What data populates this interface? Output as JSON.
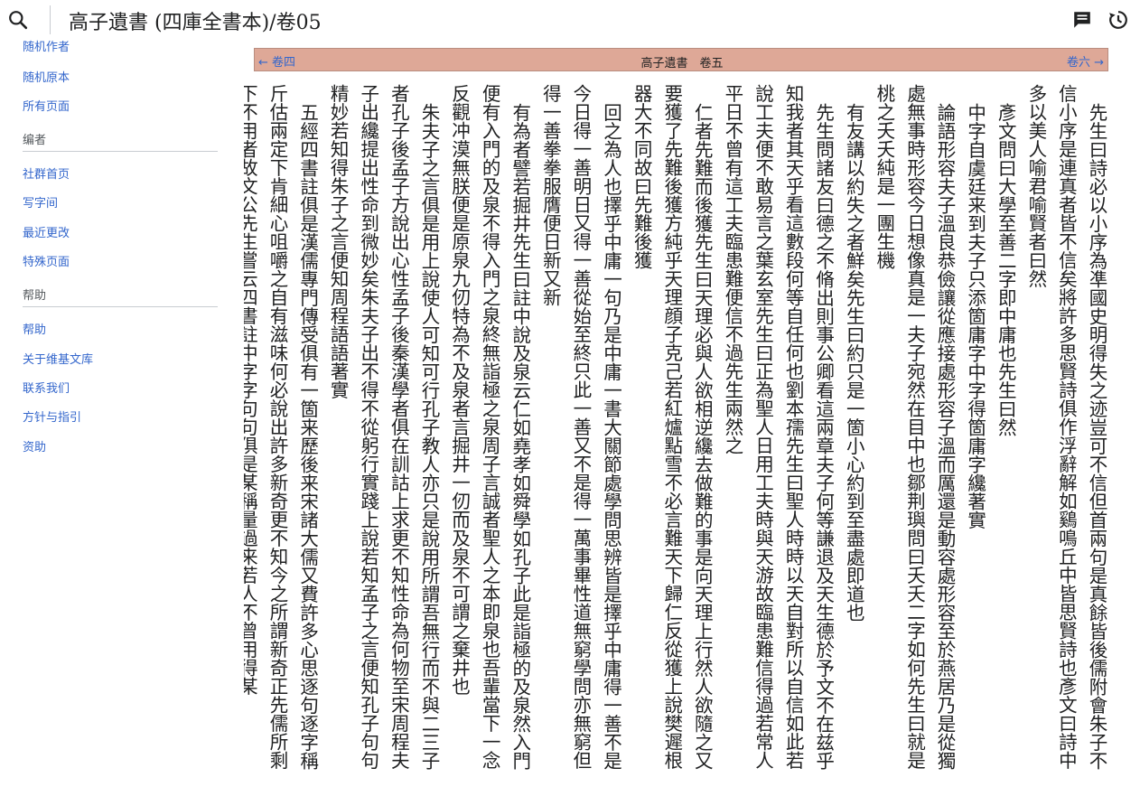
{
  "header": {
    "title": "高子遺書 (四庫全書本)/卷05",
    "icons": {
      "search": "search-icon",
      "talk": "talk-icon",
      "history": "history-icon"
    }
  },
  "sidebar": {
    "top_items": [
      "随机作者",
      "随机原本",
      "所有页面"
    ],
    "editor_heading": "编者",
    "editor_items": [
      "社群首页",
      "写字间",
      "最近更改",
      "特殊页面"
    ],
    "help_heading": "帮助",
    "help_items": [
      "帮助",
      "关于维基文库",
      "联系我们",
      "方针与指引",
      "资助"
    ]
  },
  "nav": {
    "prev": "← 卷四",
    "center": "高子遺書　卷五",
    "next": "卷六 →"
  },
  "text": {
    "paragraphs": [
      {
        "indent": true,
        "text": "先生曰詩必以小序為凖國史明得失之迹豈可不信但首兩句是真餘皆後儒附會朱子不信小序是連真者皆不信矣將許多思賢詩俱作浮辭解如鷄鳴丘中皆思賢詩也彥文曰詩中多以美人喻君喻賢者曰然"
      },
      {
        "indent": true,
        "text": "彥文問曰大學至善二字即中庸也先生曰然"
      },
      {
        "indent": true,
        "text": "中字自虞廷来到夫子只添箇庸字中字得箇庸字纔著實"
      },
      {
        "indent": true,
        "text": "論語形容夫子溫良恭儉讓從應接處形容子溫而厲還是動容處形容至於燕居乃是從獨處無事時形容今日想像真是一夫子宛然在目中也鄒荆璵問曰夭夭二字如何先生曰就是桃之夭夭純是一團生機"
      },
      {
        "indent": true,
        "text": "有友講以約失之者鮮矣先生曰約只是一箇小心約到至盡處即道也"
      },
      {
        "indent": true,
        "text": "先生問諸友曰德之不脩出則事公卿看這兩章夫子何等謙退及天生德於予文不在兹乎知我者其天乎看這數段何等自任何也劉本孺先生曰聖人時時以天自對所以自信如此若說工夫便不敢易言之葉玄室先生曰正為聖人日用工夫時與天游故臨患難信得過若常人平日不曾有這工夫臨患難便信不過先生兩然之"
      },
      {
        "indent": true,
        "text": "仁者先難而後獲先生曰天理必與人欲相逆纔去做難的事是向天理上行然人欲隨之又要獲了先難後獲方純乎天理顔子克己若紅爐點雪不必言難天下歸仁反從獲上說樊遲根器大不同故曰先難後獲"
      },
      {
        "indent": true,
        "text": "回之為人也擇乎中庸一句乃是中庸一書大關節處學問思辨皆是擇乎中庸得一善不是今日得一善明日又得一善從始至終只此一善又不是得一萬事畢性道無窮學問亦無窮但得一善拳拳服膺便日新又新"
      },
      {
        "indent": true,
        "text": "有為者譬若掘井先生曰註中說及泉云仁如堯孝如舜學如孔子此是詣極的及泉然入門便有入門的及泉不得入門之泉終無詣極之泉周子言誠者聖人之本即泉也吾輩當下一念反觀冲漠無朕便是原泉九仞特為不及泉者言掘井一仞而及泉不可謂之棄井也"
      },
      {
        "indent": true,
        "text": "朱夫子之言俱是用上說使人可知可行孔子教人亦只是說用所謂吾無行而不與二三子者孔子後孟子方說出心性孟子後秦漢學者俱在訓詁上求更不知性命為何物至宋周程夫子出纔提出性命到微妙矣朱夫子出不得不從躬行實踐上說若知孟子之言便知孔子句句精妙若知得朱子之言便知周程語語著實"
      },
      {
        "indent": true,
        "text": "五經四書註俱是漢儒專門傳受俱有一箇来歷後来宋諸大儒又費許多心思逐句逐字稱斤估兩定下肯細心咀嚼之自有滋味何必說出許多新奇更不知今之所謂新奇正先儒所剩下不用者故文公先生嘗云四書註中字字句句俱是某稱量過来若人不曾用得某"
      }
    ]
  }
}
